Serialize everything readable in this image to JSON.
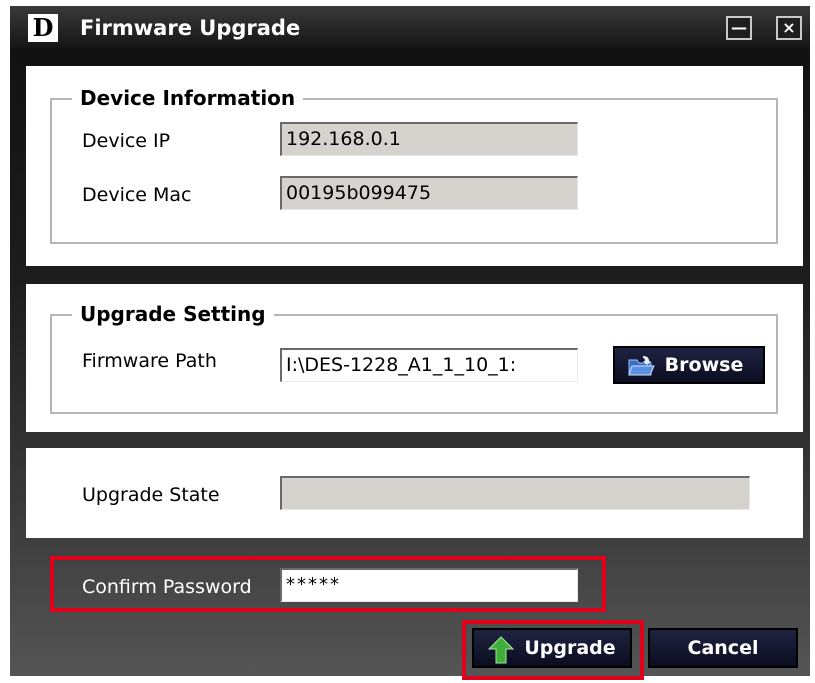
{
  "window": {
    "title": "Firmware Upgrade",
    "logo_letter": "D",
    "minimize_label": "—",
    "close_label": "×"
  },
  "device_info": {
    "heading": "Device Information",
    "ip_label": "Device IP",
    "ip_value": "192.168.0.1",
    "mac_label": "Device Mac",
    "mac_value": "00195b099475"
  },
  "upgrade_setting": {
    "heading": "Upgrade Setting",
    "path_label": "Firmware Path",
    "path_value": "I:\\DES-1228_A1_1_10_1:",
    "browse_label": "Browse"
  },
  "upgrade_state": {
    "label": "Upgrade State",
    "value": ""
  },
  "confirm_password": {
    "label": "Confirm Password",
    "value": "*****"
  },
  "actions": {
    "upgrade_label": "Upgrade",
    "cancel_label": "Cancel"
  },
  "colors": {
    "highlight": "#e0001a",
    "readonly_field": "#d6d3ce",
    "button_bg": "#0b0d20"
  },
  "icons": {
    "browse": "folder-icon",
    "upgrade": "green-up-arrow-icon"
  }
}
